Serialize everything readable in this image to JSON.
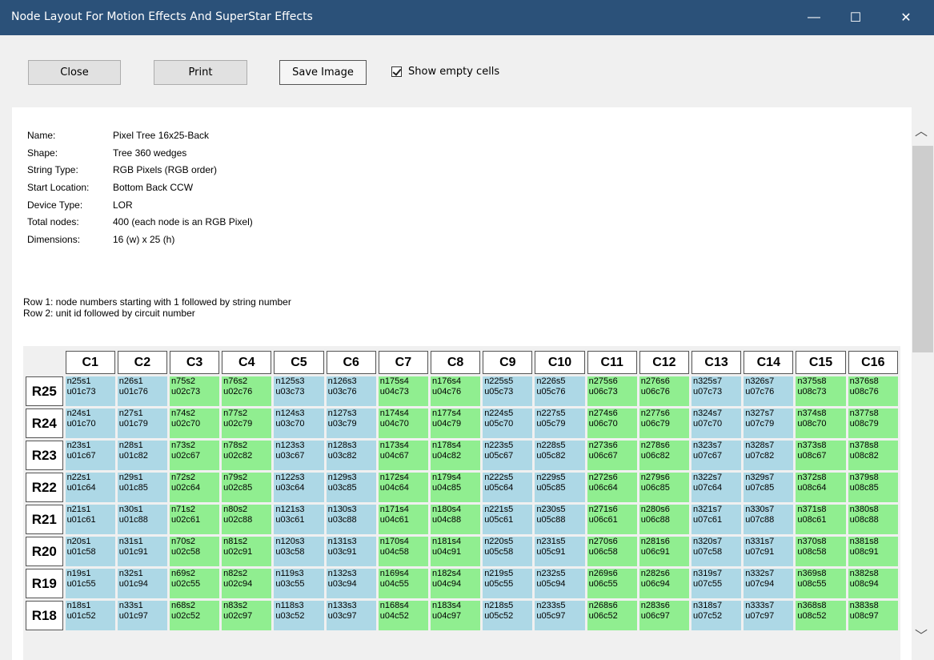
{
  "window": {
    "title": "Node Layout For Motion Effects And SuperStar Effects",
    "minimize_glyph": "—",
    "maximize_glyph": "☐",
    "close_glyph": "✕"
  },
  "toolbar": {
    "close_label": "Close",
    "print_label": "Print",
    "save_label": "Save Image",
    "show_empty_label": "Show empty cells",
    "show_empty_checked": true
  },
  "info": [
    {
      "k": "Name:",
      "v": "Pixel Tree 16x25-Back"
    },
    {
      "k": "Shape:",
      "v": "Tree 360 wedges"
    },
    {
      "k": "String Type:",
      "v": "RGB Pixels (RGB order)"
    },
    {
      "k": "Start Location:",
      "v": "Bottom Back CCW"
    },
    {
      "k": "Device Type:",
      "v": "LOR"
    },
    {
      "k": "Total nodes:",
      "v": "400 (each node is an RGB Pixel)"
    },
    {
      "k": "Dimensions:",
      "v": "16 (w) x 25 (h)"
    }
  ],
  "notes": {
    "row1": "Row 1: node numbers starting with 1 followed by string number",
    "row2": "Row 2: unit id followed by circuit number"
  },
  "grid": {
    "columns": [
      "C1",
      "C2",
      "C3",
      "C4",
      "C5",
      "C6",
      "C7",
      "C8",
      "C9",
      "C10",
      "C11",
      "C12",
      "C13",
      "C14",
      "C15",
      "C16"
    ],
    "colors": {
      "blue": "#add8e6",
      "green": "#90ee90"
    },
    "column_colors": [
      "blue",
      "blue",
      "green",
      "green",
      "blue",
      "blue",
      "green",
      "green",
      "blue",
      "blue",
      "green",
      "green",
      "blue",
      "blue",
      "green",
      "green"
    ],
    "rows": [
      {
        "label": "R25",
        "cells": [
          [
            "n25s1",
            "u01c73"
          ],
          [
            "n26s1",
            "u01c76"
          ],
          [
            "n75s2",
            "u02c73"
          ],
          [
            "n76s2",
            "u02c76"
          ],
          [
            "n125s3",
            "u03c73"
          ],
          [
            "n126s3",
            "u03c76"
          ],
          [
            "n175s4",
            "u04c73"
          ],
          [
            "n176s4",
            "u04c76"
          ],
          [
            "n225s5",
            "u05c73"
          ],
          [
            "n226s5",
            "u05c76"
          ],
          [
            "n275s6",
            "u06c73"
          ],
          [
            "n276s6",
            "u06c76"
          ],
          [
            "n325s7",
            "u07c73"
          ],
          [
            "n326s7",
            "u07c76"
          ],
          [
            "n375s8",
            "u08c73"
          ],
          [
            "n376s8",
            "u08c76"
          ]
        ]
      },
      {
        "label": "R24",
        "cells": [
          [
            "n24s1",
            "u01c70"
          ],
          [
            "n27s1",
            "u01c79"
          ],
          [
            "n74s2",
            "u02c70"
          ],
          [
            "n77s2",
            "u02c79"
          ],
          [
            "n124s3",
            "u03c70"
          ],
          [
            "n127s3",
            "u03c79"
          ],
          [
            "n174s4",
            "u04c70"
          ],
          [
            "n177s4",
            "u04c79"
          ],
          [
            "n224s5",
            "u05c70"
          ],
          [
            "n227s5",
            "u05c79"
          ],
          [
            "n274s6",
            "u06c70"
          ],
          [
            "n277s6",
            "u06c79"
          ],
          [
            "n324s7",
            "u07c70"
          ],
          [
            "n327s7",
            "u07c79"
          ],
          [
            "n374s8",
            "u08c70"
          ],
          [
            "n377s8",
            "u08c79"
          ]
        ]
      },
      {
        "label": "R23",
        "cells": [
          [
            "n23s1",
            "u01c67"
          ],
          [
            "n28s1",
            "u01c82"
          ],
          [
            "n73s2",
            "u02c67"
          ],
          [
            "n78s2",
            "u02c82"
          ],
          [
            "n123s3",
            "u03c67"
          ],
          [
            "n128s3",
            "u03c82"
          ],
          [
            "n173s4",
            "u04c67"
          ],
          [
            "n178s4",
            "u04c82"
          ],
          [
            "n223s5",
            "u05c67"
          ],
          [
            "n228s5",
            "u05c82"
          ],
          [
            "n273s6",
            "u06c67"
          ],
          [
            "n278s6",
            "u06c82"
          ],
          [
            "n323s7",
            "u07c67"
          ],
          [
            "n328s7",
            "u07c82"
          ],
          [
            "n373s8",
            "u08c67"
          ],
          [
            "n378s8",
            "u08c82"
          ]
        ]
      },
      {
        "label": "R22",
        "cells": [
          [
            "n22s1",
            "u01c64"
          ],
          [
            "n29s1",
            "u01c85"
          ],
          [
            "n72s2",
            "u02c64"
          ],
          [
            "n79s2",
            "u02c85"
          ],
          [
            "n122s3",
            "u03c64"
          ],
          [
            "n129s3",
            "u03c85"
          ],
          [
            "n172s4",
            "u04c64"
          ],
          [
            "n179s4",
            "u04c85"
          ],
          [
            "n222s5",
            "u05c64"
          ],
          [
            "n229s5",
            "u05c85"
          ],
          [
            "n272s6",
            "u06c64"
          ],
          [
            "n279s6",
            "u06c85"
          ],
          [
            "n322s7",
            "u07c64"
          ],
          [
            "n329s7",
            "u07c85"
          ],
          [
            "n372s8",
            "u08c64"
          ],
          [
            "n379s8",
            "u08c85"
          ]
        ]
      },
      {
        "label": "R21",
        "cells": [
          [
            "n21s1",
            "u01c61"
          ],
          [
            "n30s1",
            "u01c88"
          ],
          [
            "n71s2",
            "u02c61"
          ],
          [
            "n80s2",
            "u02c88"
          ],
          [
            "n121s3",
            "u03c61"
          ],
          [
            "n130s3",
            "u03c88"
          ],
          [
            "n171s4",
            "u04c61"
          ],
          [
            "n180s4",
            "u04c88"
          ],
          [
            "n221s5",
            "u05c61"
          ],
          [
            "n230s5",
            "u05c88"
          ],
          [
            "n271s6",
            "u06c61"
          ],
          [
            "n280s6",
            "u06c88"
          ],
          [
            "n321s7",
            "u07c61"
          ],
          [
            "n330s7",
            "u07c88"
          ],
          [
            "n371s8",
            "u08c61"
          ],
          [
            "n380s8",
            "u08c88"
          ]
        ]
      },
      {
        "label": "R20",
        "cells": [
          [
            "n20s1",
            "u01c58"
          ],
          [
            "n31s1",
            "u01c91"
          ],
          [
            "n70s2",
            "u02c58"
          ],
          [
            "n81s2",
            "u02c91"
          ],
          [
            "n120s3",
            "u03c58"
          ],
          [
            "n131s3",
            "u03c91"
          ],
          [
            "n170s4",
            "u04c58"
          ],
          [
            "n181s4",
            "u04c91"
          ],
          [
            "n220s5",
            "u05c58"
          ],
          [
            "n231s5",
            "u05c91"
          ],
          [
            "n270s6",
            "u06c58"
          ],
          [
            "n281s6",
            "u06c91"
          ],
          [
            "n320s7",
            "u07c58"
          ],
          [
            "n331s7",
            "u07c91"
          ],
          [
            "n370s8",
            "u08c58"
          ],
          [
            "n381s8",
            "u08c91"
          ]
        ]
      },
      {
        "label": "R19",
        "cells": [
          [
            "n19s1",
            "u01c55"
          ],
          [
            "n32s1",
            "u01c94"
          ],
          [
            "n69s2",
            "u02c55"
          ],
          [
            "n82s2",
            "u02c94"
          ],
          [
            "n119s3",
            "u03c55"
          ],
          [
            "n132s3",
            "u03c94"
          ],
          [
            "n169s4",
            "u04c55"
          ],
          [
            "n182s4",
            "u04c94"
          ],
          [
            "n219s5",
            "u05c55"
          ],
          [
            "n232s5",
            "u05c94"
          ],
          [
            "n269s6",
            "u06c55"
          ],
          [
            "n282s6",
            "u06c94"
          ],
          [
            "n319s7",
            "u07c55"
          ],
          [
            "n332s7",
            "u07c94"
          ],
          [
            "n369s8",
            "u08c55"
          ],
          [
            "n382s8",
            "u08c94"
          ]
        ]
      },
      {
        "label": "R18",
        "cells": [
          [
            "n18s1",
            "u01c52"
          ],
          [
            "n33s1",
            "u01c97"
          ],
          [
            "n68s2",
            "u02c52"
          ],
          [
            "n83s2",
            "u02c97"
          ],
          [
            "n118s3",
            "u03c52"
          ],
          [
            "n133s3",
            "u03c97"
          ],
          [
            "n168s4",
            "u04c52"
          ],
          [
            "n183s4",
            "u04c97"
          ],
          [
            "n218s5",
            "u05c52"
          ],
          [
            "n233s5",
            "u05c97"
          ],
          [
            "n268s6",
            "u06c52"
          ],
          [
            "n283s6",
            "u06c97"
          ],
          [
            "n318s7",
            "u07c52"
          ],
          [
            "n333s7",
            "u07c97"
          ],
          [
            "n368s8",
            "u08c52"
          ],
          [
            "n383s8",
            "u08c97"
          ]
        ]
      }
    ]
  },
  "scrollbar": {
    "up_glyph": "︿",
    "down_glyph": "﹀"
  }
}
